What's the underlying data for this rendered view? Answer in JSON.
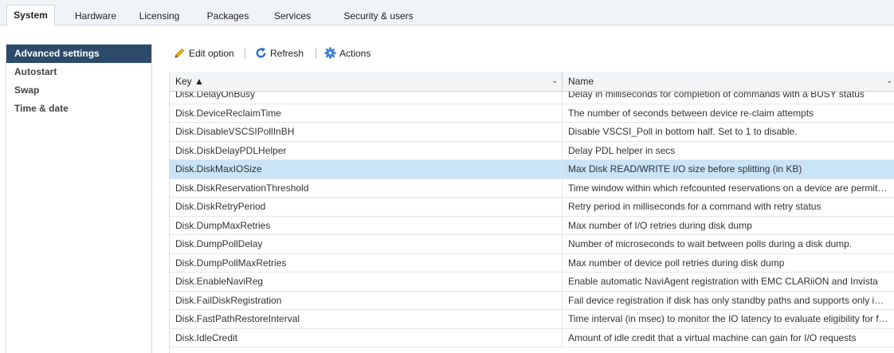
{
  "tabs": [
    {
      "label": "System",
      "active": true
    },
    {
      "label": "Hardware"
    },
    {
      "label": "Licensing"
    },
    {
      "label": "Packages"
    },
    {
      "label": "Services"
    },
    {
      "label": "Security & users"
    }
  ],
  "sidebar": {
    "items": [
      {
        "label": "Advanced settings",
        "active": true
      },
      {
        "label": "Autostart"
      },
      {
        "label": "Swap"
      },
      {
        "label": "Time & date"
      }
    ]
  },
  "toolbar": {
    "edit_label": "Edit option",
    "refresh_label": "Refresh",
    "actions_label": "Actions"
  },
  "table": {
    "columns": {
      "key": "Key ▲",
      "name": "Name"
    },
    "rows": [
      {
        "key": "Disk.DelayOnBusy",
        "name": "Delay in milliseconds for completion of commands with a BUSY status"
      },
      {
        "key": "Disk.DeviceReclaimTime",
        "name": "The number of seconds between device re-claim attempts"
      },
      {
        "key": "Disk.DisableVSCSIPollInBH",
        "name": "Disable VSCSI_Poll in bottom half. Set to 1 to disable."
      },
      {
        "key": "Disk.DiskDelayPDLHelper",
        "name": "Delay PDL helper in secs"
      },
      {
        "key": "Disk.DiskMaxIOSize",
        "name": "Max Disk READ/WRITE I/O size before splitting (in KB)",
        "selected": true
      },
      {
        "key": "Disk.DiskReservationThreshold",
        "name": "Time window within which refcounted reservations on a device are permitted"
      },
      {
        "key": "Disk.DiskRetryPeriod",
        "name": "Retry period in milliseconds for a command with retry status"
      },
      {
        "key": "Disk.DumpMaxRetries",
        "name": "Max number of I/O retries during disk dump"
      },
      {
        "key": "Disk.DumpPollDelay",
        "name": "Number of microseconds to wait between polls during a disk dump."
      },
      {
        "key": "Disk.DumpPollMaxRetries",
        "name": "Max number of device poll retries during disk dump"
      },
      {
        "key": "Disk.EnableNaviReg",
        "name": "Enable automatic NaviAgent registration with EMC CLARiiON and Invista"
      },
      {
        "key": "Disk.FailDiskRegistration",
        "name": "Fail device registration if disk has only standby paths and supports only implicit asymmetric access"
      },
      {
        "key": "Disk.FastPathRestoreInterval",
        "name": "Time interval (in msec) to monitor the IO latency to evaluate eligibility for fast path"
      },
      {
        "key": "Disk.IdleCredit",
        "name": "Amount of idle credit that a virtual machine can gain for I/O requests"
      }
    ]
  },
  "colors": {
    "nav_active": "#2c4a6a",
    "row_selected": "#c9e4f7",
    "refresh_icon": "#2a6fc9",
    "actions_icon": "#3b7fd0",
    "edit_icon": "#e0a000"
  },
  "icons": {
    "edit": "pencil-icon",
    "refresh": "refresh-icon",
    "actions": "gear-icon",
    "sort": "sort-asc-icon",
    "column_menu": "chevron-down-icon"
  }
}
